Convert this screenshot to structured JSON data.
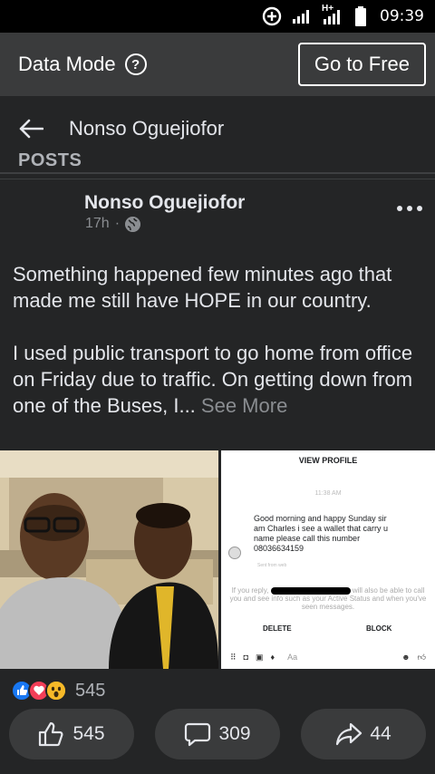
{
  "status_bar": {
    "time": "09:39",
    "network": "H+"
  },
  "data_mode": {
    "label": "Data Mode",
    "help_glyph": "?",
    "go_to_free": "Go to Free"
  },
  "nav": {
    "title": "Nonso Oguejiofor"
  },
  "section_label": "Posts",
  "post": {
    "author": "Nonso Oguejiofor",
    "time": "17h",
    "separator": "·",
    "paragraph1": "Something happened few minutes ago that made me still have HOPE in our country.",
    "paragraph2": "I used public transport to go home from office on Friday due to traffic. On getting down from one of the Buses, I...",
    "see_more": "See More"
  },
  "screenshot": {
    "view_profile": "VIEW PROFILE",
    "timestamp": "11:38 AM",
    "message": "Good morning and happy Sunday sir am Charles i see a wallet  that carry u name please call this number 08036634159",
    "sent_from": "Sent from web",
    "notice_start": "If you reply,",
    "notice_end": "will also be able to call you and see info such as your Active Status and when you've seen messages.",
    "delete": "DELETE",
    "block": "BLOCK",
    "composer_placeholder": "Aa"
  },
  "reactions": {
    "count": "545",
    "types": [
      "like",
      "love",
      "wow"
    ]
  },
  "actions": {
    "like_count": "545",
    "comment_count": "309",
    "share_count": "44"
  },
  "colors": {
    "background": "#242526",
    "bar": "#3a3b3c",
    "like_blue": "#1877f2",
    "love_red": "#f33e58",
    "wow_yellow": "#f7b928"
  }
}
